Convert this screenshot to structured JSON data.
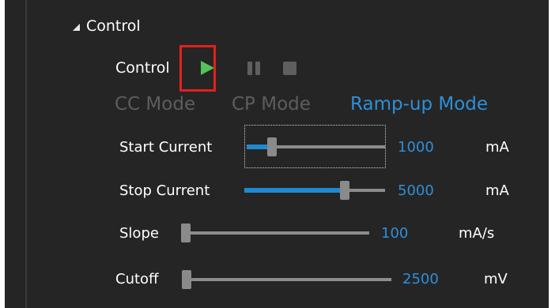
{
  "group": {
    "title": "Control"
  },
  "control_row": {
    "label": "Control"
  },
  "modes": [
    {
      "label": "CC Mode",
      "active": false
    },
    {
      "label": "CP Mode",
      "active": false
    },
    {
      "label": "Ramp-up Mode",
      "active": true
    }
  ],
  "params": [
    {
      "label": "Start Current",
      "value": "1000",
      "unit": "mA",
      "fraction": 0.16
    },
    {
      "label": "Stop Current",
      "value": "5000",
      "unit": "mA",
      "fraction": 0.73
    },
    {
      "label": "Slope",
      "value": "100",
      "unit": "mA/s",
      "fraction": 0.0
    },
    {
      "label": "Cutoff",
      "value": "2500",
      "unit": "mV",
      "fraction": 0.0
    }
  ],
  "icons": {
    "expand": "expander-triangle-icon",
    "play": "play-icon",
    "pause": "pause-icon",
    "stop": "stop-icon"
  },
  "colors": {
    "accent": "#2f8fd6",
    "play": "#56c25a",
    "highlight": "#e02020",
    "background": "#252526"
  }
}
